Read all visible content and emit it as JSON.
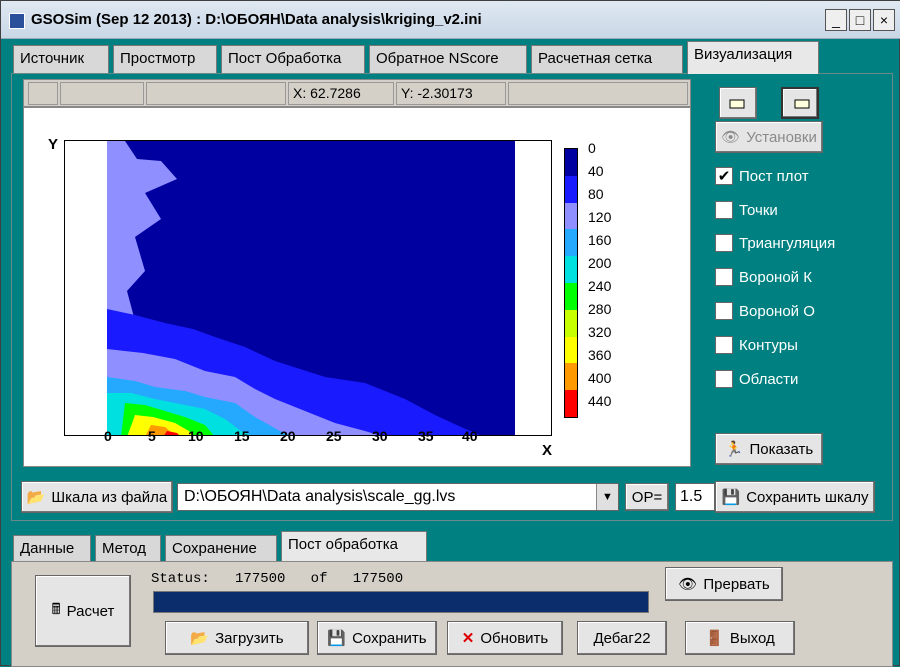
{
  "window": {
    "title": "GSOSim (Sep 12 2013) : D:\\ОБОЯН\\Data analysis\\kriging_v2.ini"
  },
  "tabs": [
    "Источник",
    "Простмотр",
    "Пост Обработка",
    "Обратное NScore",
    "Расчетная сетка",
    "Визуализация"
  ],
  "coords": {
    "x_label": "X:",
    "x_value": "62.7286",
    "y_label": "Y:",
    "y_value": "-2.30173"
  },
  "plot": {
    "y_axis": "Y",
    "x_axis": "X",
    "x_ticks": [
      "0",
      "5",
      "10",
      "15",
      "20",
      "25",
      "30",
      "35",
      "40"
    ],
    "colorbar_labels": [
      "0",
      "40",
      "80",
      "120",
      "160",
      "200",
      "240",
      "280",
      "320",
      "360",
      "400",
      "440"
    ],
    "colorbar_colors": [
      "#0000a0",
      "#1a1aff",
      "#8f8fff",
      "#25a9ff",
      "#00e0e0",
      "#00ff00",
      "#c8ff00",
      "#ffff00",
      "#ff9900",
      "#ff0000",
      "#ff00ff",
      "#ff99ff"
    ]
  },
  "right_panel": {
    "settings_label": "Установки",
    "checkboxes": [
      {
        "label": "Пост плот",
        "checked": true
      },
      {
        "label": "Точки",
        "checked": false
      },
      {
        "label": "Триангуляция",
        "checked": false
      },
      {
        "label": "Вороной К",
        "checked": false
      },
      {
        "label": "Вороной О",
        "checked": false
      },
      {
        "label": "Контуры",
        "checked": false
      },
      {
        "label": "Области",
        "checked": false
      }
    ],
    "show_button": "Показать"
  },
  "scale_row": {
    "scale_button": "Шкала из файла",
    "scale_path": "D:\\ОБОЯН\\Data analysis\\scale_gg.lvs",
    "op_label": "ОР=",
    "op_value": "1.5",
    "save_scale": "Сохранить шкалу"
  },
  "bottom_tabs": [
    "Данные",
    "Метод",
    "Сохранение",
    "Пост обработка"
  ],
  "status": {
    "label": "Status:",
    "current": "177500",
    "of": "of",
    "total": "177500",
    "progress_fraction": 1.0
  },
  "buttons": {
    "calc": "Расчет",
    "load": "Загрузить",
    "save": "Сохранить",
    "refresh": "Обновить",
    "debug": "Дебаг22",
    "interrupt": "Прервать",
    "exit": "Выход"
  }
}
